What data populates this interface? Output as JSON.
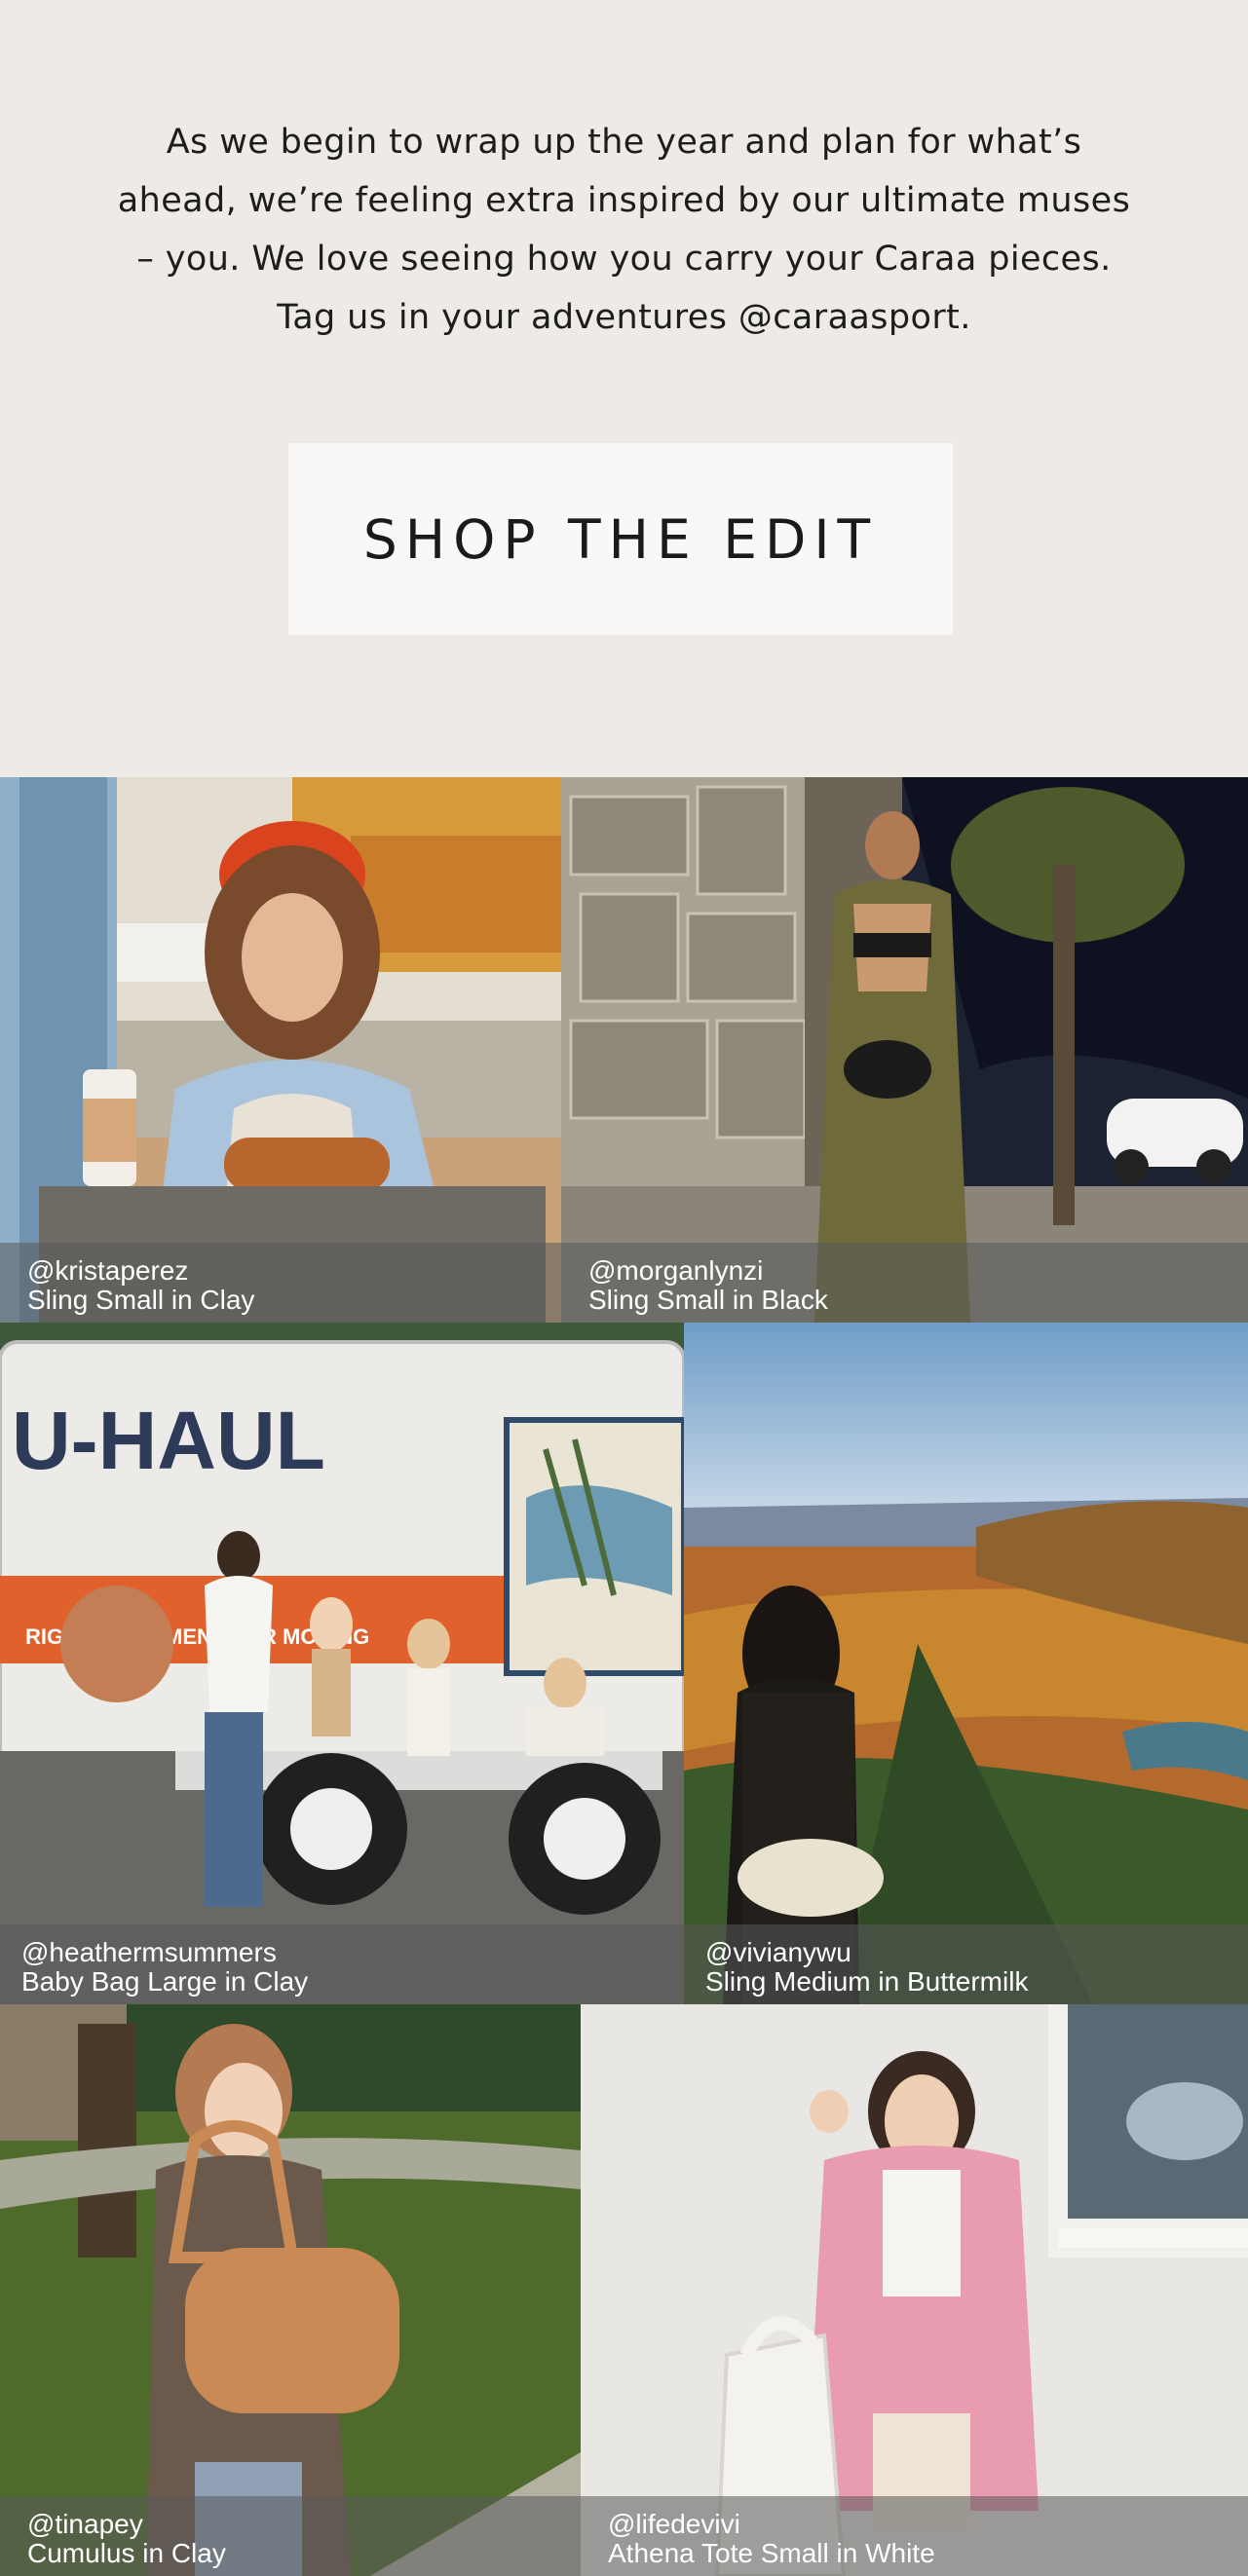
{
  "intro": {
    "text": "As we begin to wrap up the year and plan for what’s ahead, we’re feeling extra inspired by our ultimate muses – you. We love seeing how you carry your Caraa pieces. Tag us in your adventures @caraasport."
  },
  "cta": {
    "label": "SHOP THE EDIT"
  },
  "gallery": [
    {
      "handle": "@kristaperez",
      "product": "Sling Small in Clay"
    },
    {
      "handle": "@morganlynzi",
      "product": "Sling Small in Black"
    },
    {
      "handle": "@heathermsummers",
      "product": "Baby Bag Large in Clay"
    },
    {
      "handle": "@vivianywu",
      "product": "Sling Medium in Buttermilk"
    },
    {
      "handle": "@tinapey",
      "product": "Cumulus in Clay"
    },
    {
      "handle": "@lifedevivi",
      "product": "Athena Tote Small in White"
    }
  ],
  "photo_text": {
    "truck_brand": "U-HAUL",
    "truck_slogan": "RIGHT EQUIPMENT FOR MOVING"
  },
  "colors": {
    "background": "#eeebe6",
    "button_bg": "#f9f8f6",
    "caption_overlay": "rgba(90,90,90,0.55)"
  }
}
